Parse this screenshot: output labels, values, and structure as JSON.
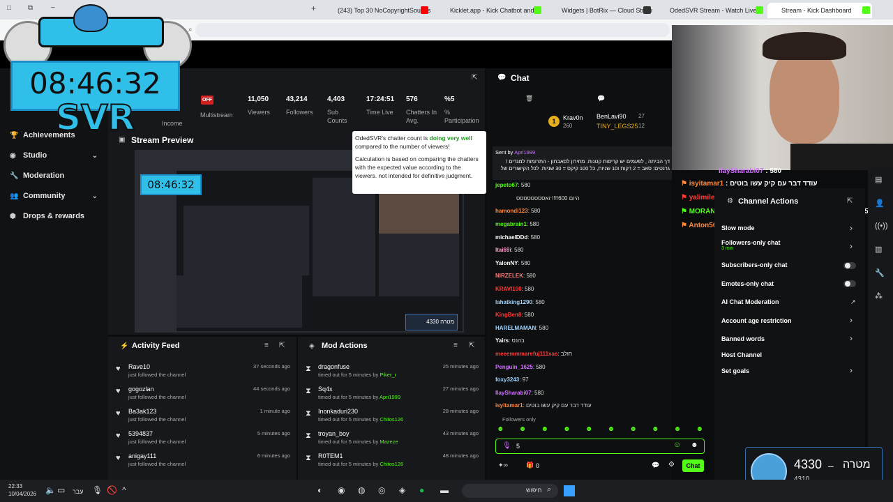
{
  "browser": {
    "tabs": [
      {
        "label": "(243) Top 30 NoCopyrightSounds",
        "color": "#ff0000"
      },
      {
        "label": "Kicklet.app - Kick Chatbot and",
        "color": "#53fc18"
      },
      {
        "label": "Widgets | BotRix — Cloud Stream",
        "color": "#ffffff"
      },
      {
        "label": "OdedSVR Stream - Watch Live",
        "color": "#53fc18"
      },
      {
        "label": "Stream - Kick Dashboard",
        "color": "#53fc18"
      }
    ]
  },
  "overlay": {
    "clock": "08:46:32",
    "logo_text": "SVR"
  },
  "sidebar": {
    "items": [
      {
        "label": "Achievements",
        "icon": "trophy-icon",
        "chevron": false
      },
      {
        "label": "Studio",
        "icon": "studio-icon",
        "chevron": true
      },
      {
        "label": "Moderation",
        "icon": "wrench-icon",
        "chevron": false
      },
      {
        "label": "Community",
        "icon": "users-icon",
        "chevron": true
      },
      {
        "label": "Drops & rewards",
        "icon": "drops-icon",
        "chevron": false
      }
    ]
  },
  "stats": {
    "income_label": "Income",
    "status_badge": "OFF",
    "status_label": "Multistream",
    "items": [
      {
        "value": "11,050",
        "label": "Viewers"
      },
      {
        "value": "43,214",
        "label": "Followers"
      },
      {
        "value": "4,403",
        "label": "Sub Counts"
      },
      {
        "value": "17:24:51",
        "label": "Time Live"
      },
      {
        "value": "576",
        "label": "Chatters In Avg."
      },
      {
        "value": "%5",
        "label": "% Participation"
      }
    ]
  },
  "preview": {
    "title": "Stream Preview",
    "viewer_badge": "4330 מטרה"
  },
  "tooltip": {
    "line1_pre": "OdedSVR's chatter count is ",
    "line1_good": "doing very well",
    "line1_post": " compared to the number of viewers!",
    "line2": "Calculation is based on comparing the chatters with the expected value according to the viewers. not intended for definitive judgment."
  },
  "activity": {
    "title": "Activity Feed",
    "items": [
      {
        "name": "Rave10",
        "action": "just followed the channel",
        "time": "37 seconds ago"
      },
      {
        "name": "gogozlan",
        "action": "just followed the channel",
        "time": "44 seconds ago"
      },
      {
        "name": "Ba3ak123",
        "action": "just followed the channel",
        "time": "1 minute ago"
      },
      {
        "name": "5394837",
        "action": "just followed the channel",
        "time": "5 minutes ago"
      },
      {
        "name": "anigay111",
        "action": "just followed the channel",
        "time": "6 minutes ago"
      }
    ]
  },
  "mod": {
    "title": "Mod Actions",
    "items": [
      {
        "name": "dragonfuse",
        "action": "timed out for 5 minutes by",
        "by": "Piker_r",
        "time": "25 minutes ago"
      },
      {
        "name": "Sq4x",
        "action": "timed out for 5 minutes by",
        "by": "Apri1999",
        "time": "27 minutes ago"
      },
      {
        "name": "Inonkaduri230",
        "action": "timed out for 5 minutes by",
        "by": "Chitos126",
        "time": "28 minutes ago"
      },
      {
        "name": "troyan_boy",
        "action": "timed out for 5 minutes by",
        "by": "Mazeze",
        "time": "43 minutes ago"
      },
      {
        "name": "R0TEM1",
        "action": "timed out for 5 minutes by",
        "by": "Chitos126",
        "time": "48 minutes ago"
      }
    ]
  },
  "chat": {
    "title": "Chat",
    "leaderboard": [
      {
        "name": "Krav0n",
        "score": "260"
      },
      {
        "name": "BenLavi90",
        "score": "27"
      },
      {
        "name": "TINY_LEGS25",
        "score": "12"
      }
    ],
    "sent_by": "Sent by",
    "sent_by_user": "Apri1999",
    "pinned": "דך הביתה , לפעמים יש קריסות קטנות. מחירון לסאבתון - התרומות למגדים / גרנטים: סאב = 2 דקות ו10 שניות, כל 100 קיקס = 30 שניות. לכל הקישורים של",
    "messages": [
      {
        "user": "jepeto67",
        "color": "#53fc18",
        "text": "580"
      },
      {
        "user": "",
        "color": "#ffffff",
        "text": "היום 600!!!! זאסססססססס"
      },
      {
        "user": "hamondi123",
        "color": "#ff8a3d",
        "text": "580"
      },
      {
        "user": "megabrain1",
        "color": "#53fc18",
        "text": "580"
      },
      {
        "user": "michaelDDd",
        "color": "#ffffff",
        "text": "580"
      },
      {
        "user": "Itai69i",
        "color": "#ff9ecf",
        "text": "580"
      },
      {
        "user": "YalonNY",
        "color": "#ffffff",
        "text": "580"
      },
      {
        "user": "NIRZELEK",
        "color": "#ff7a7a",
        "text": "580"
      },
      {
        "user": "KRAVI100",
        "color": "#ff3b3b",
        "text": "580"
      },
      {
        "user": "lahatking1290",
        "color": "#9fd4ff",
        "text": "580"
      },
      {
        "user": "KingBen8",
        "color": "#ff3b3b",
        "text": "580"
      },
      {
        "user": "HARELMAMAN",
        "color": "#9fd4ff",
        "text": "580"
      },
      {
        "user": "Yairs",
        "color": "#ffffff",
        "text": "בהנס"
      },
      {
        "user": "meeemmmarefuj111xas",
        "color": "#ff3b3b",
        "text": "חולב"
      },
      {
        "user": "Penguin_1625",
        "color": "#d070ff",
        "text": "580"
      },
      {
        "user": "foxy3243",
        "color": "#9fd4ff",
        "text": "97"
      },
      {
        "user": "IlaySharabi07",
        "color": "#d070ff",
        "text": "580"
      },
      {
        "user": "isyitamar1",
        "color": "#ff8a3d",
        "text": "עודד דבר עם קיק עשו בוטים"
      }
    ],
    "followers_only": "Followers only",
    "input_value": "5",
    "bottom_count": "0",
    "send_label": "Chat"
  },
  "stream_overlay_chat": [
    {
      "user": "IlaySharabi07",
      "text": "580",
      "color": "#d070ff"
    },
    {
      "user": "isyitamar1",
      "text": "עודד דבר עם קיק עשו בוטים",
      "color": "#ff8a3d"
    },
    {
      "user": "yalimile",
      "text": "580",
      "color": "#ff3b3b"
    },
    {
      "user": "MORANGG1",
      "text": "580580580580580580580580580580580580580",
      "color": "#53fc18"
    },
    {
      "user": "Anton5678",
      "text": "580",
      "color": "#ff8a3d"
    }
  ],
  "channel_actions": {
    "title": "Channel Actions",
    "items": [
      {
        "label": "Slow mode",
        "sub": "",
        "control": "chevron"
      },
      {
        "label": "Followers-only chat",
        "sub": "3 min",
        "control": "chevron"
      },
      {
        "label": "Subscribers-only chat",
        "sub": "",
        "control": "toggle"
      },
      {
        "label": "Emotes-only chat",
        "sub": "",
        "control": "toggle"
      },
      {
        "label": "AI Chat Moderation",
        "sub": "",
        "control": "external"
      },
      {
        "label": "Account age restriction",
        "sub": "",
        "control": "chevron"
      },
      {
        "label": "Banned words",
        "sub": "",
        "control": "chevron"
      },
      {
        "label": "Host Channel",
        "sub": "",
        "control": "none"
      },
      {
        "label": "Set goals",
        "sub": "",
        "control": "chevron"
      }
    ]
  },
  "goal_widget": {
    "value": "4330",
    "label": "מטרה",
    "sub": "4310"
  },
  "taskbar": {
    "time": "22:33",
    "date": "10/04/2026",
    "lang": "עבר",
    "search_placeholder": "חיפוש"
  },
  "colors": {
    "accent": "#53fc18",
    "panel": "#17181b",
    "bg": "#0b0c0d",
    "overlay_blue": "#2fbfe8"
  }
}
